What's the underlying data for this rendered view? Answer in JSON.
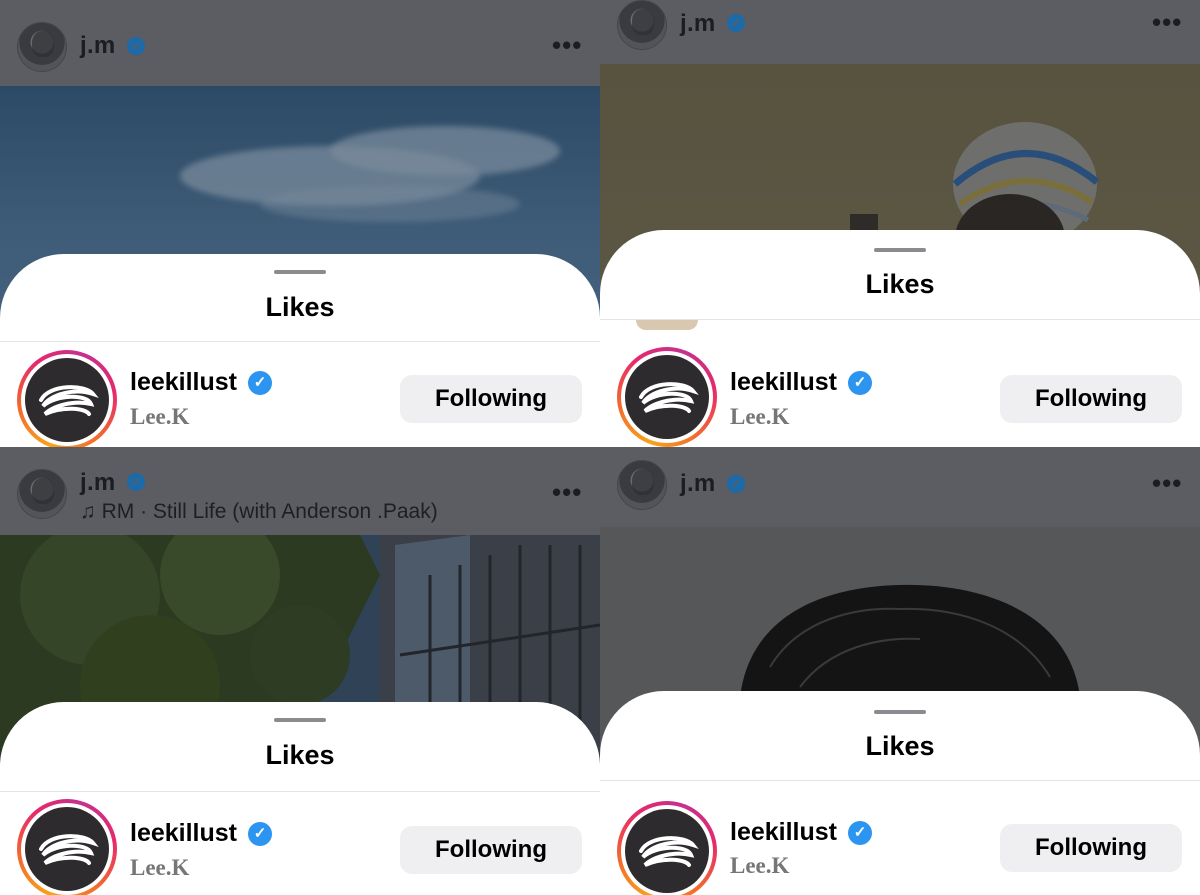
{
  "panels": [
    {
      "header": {
        "username": "j.m",
        "verified_mark": "✓",
        "more": "•••"
      },
      "sheet": {
        "title": "Likes"
      },
      "liker": {
        "username": "leekillust",
        "verified_mark": "✓",
        "full_name": "Lee.K",
        "button": "Following"
      }
    },
    {
      "header": {
        "username": "j.m",
        "verified_mark": "✓",
        "more": "•••"
      },
      "sheet": {
        "title": "Likes"
      },
      "liker": {
        "username": "leekillust",
        "verified_mark": "✓",
        "full_name": "Lee.K",
        "button": "Following"
      }
    },
    {
      "header": {
        "username": "j.m",
        "verified_mark": "✓",
        "more": "•••",
        "music_note": "♫",
        "music": "RM · Still Life (with Anderson .Paak)"
      },
      "sheet": {
        "title": "Likes"
      },
      "liker": {
        "username": "leekillust",
        "verified_mark": "✓",
        "full_name": "Lee.K",
        "button": "Following"
      }
    },
    {
      "header": {
        "username": "j.m",
        "verified_mark": "✓",
        "more": "•••"
      },
      "sheet": {
        "title": "Likes"
      },
      "liker": {
        "username": "leekillust",
        "verified_mark": "✓",
        "full_name": "Lee.K",
        "button": "Following"
      }
    }
  ],
  "icons": {
    "verified": "verified-badge-icon",
    "more": "more-options-icon",
    "music": "music-note-icon",
    "avatar": "profile-avatar"
  },
  "colors": {
    "verified_blue": "#2b95f0",
    "story_ring_start": "#f9a21b",
    "story_ring_end": "#c5308f",
    "button_bg": "#efeff1",
    "dim_overlay": "#5a5c62"
  }
}
